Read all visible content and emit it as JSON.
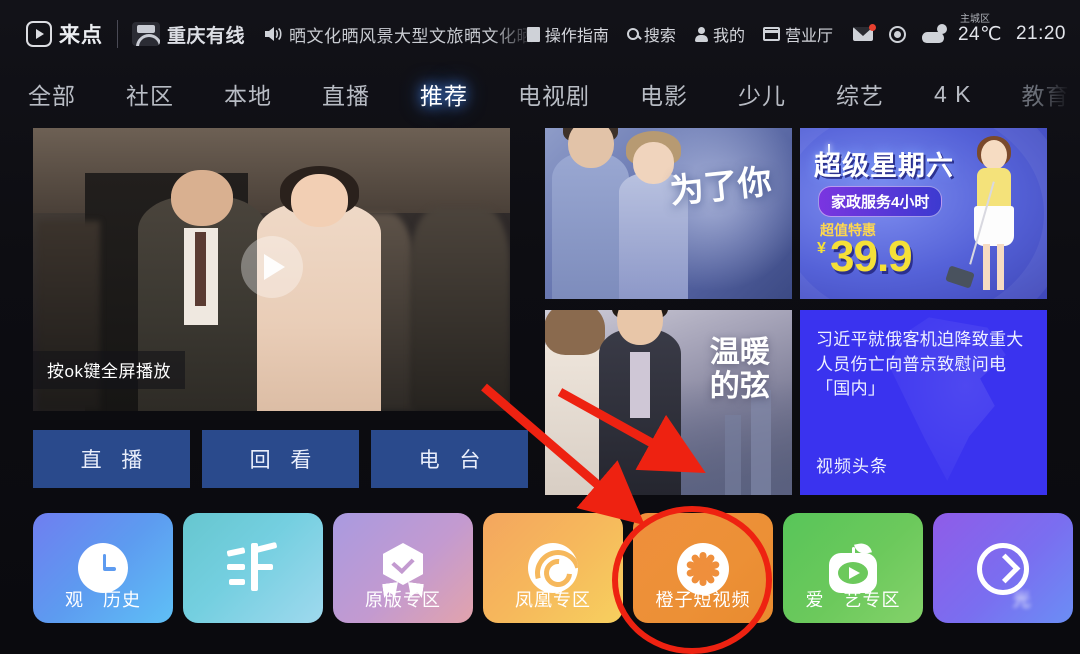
{
  "header": {
    "brand": "来点",
    "brand_icon": "play-logo-icon",
    "operator": "重庆有线",
    "operator_icon": "cable-wifi-icon",
    "speaker_icon": "speaker-icon",
    "marquee": "晒文化晒风景大型文旅晒文化晒",
    "menu": [
      {
        "label": "操作指南",
        "icon": "guide-book-icon"
      },
      {
        "label": "搜索",
        "icon": "search-icon"
      },
      {
        "label": "我的",
        "icon": "user-icon"
      },
      {
        "label": "营业厅",
        "icon": "shop-icon"
      }
    ],
    "mail_icon": "mail-icon",
    "mail_badge": true,
    "target_icon": "target-icon",
    "weather_icon": "sun-cloud-icon",
    "region": "主城区",
    "temperature": "24℃",
    "time": "21:20"
  },
  "nav": {
    "tabs": [
      {
        "label": "全部",
        "active": false
      },
      {
        "label": "社区",
        "active": false
      },
      {
        "label": "本地",
        "active": false
      },
      {
        "label": "直播",
        "active": false
      },
      {
        "label": "推荐",
        "active": true
      },
      {
        "label": "电视剧",
        "active": false
      },
      {
        "label": "电影",
        "active": false
      },
      {
        "label": "少儿",
        "active": false
      },
      {
        "label": "综艺",
        "active": false
      },
      {
        "label": "4 K",
        "active": false
      },
      {
        "label": "教育",
        "active": false
      }
    ]
  },
  "main": {
    "player": {
      "hint": "按ok键全屏播放",
      "play_icon": "play-icon"
    },
    "buttons": [
      {
        "label": "直 播"
      },
      {
        "label": "回 看"
      },
      {
        "label": "电 台"
      }
    ],
    "cards": {
      "drama_top": {
        "title": "为了你"
      },
      "ad": {
        "title": "超级星期六",
        "pill": "家政服务4小时",
        "subtitle": "超值特惠",
        "currency": "¥",
        "price": "39.9"
      },
      "drama_bottom": {
        "title_line1": "温暖",
        "title_line2": "的弦"
      },
      "news": {
        "headline": "习近平就俄客机迫降致重大人员伤亡向普京致慰问电「国内」",
        "tag": "视频头条"
      }
    }
  },
  "tiles": [
    {
      "label": "观　历史",
      "icon": "clock-icon",
      "blur": false,
      "highlighted": false
    },
    {
      "label": "",
      "icon": "fun-text-icon",
      "blur": true,
      "highlighted": false
    },
    {
      "label": "原版专区",
      "icon": "badge-check-icon",
      "blur": false,
      "highlighted": false
    },
    {
      "label": "凤凰专区",
      "icon": "phoenix-icon",
      "blur": false,
      "highlighted": false
    },
    {
      "label": "橙子短视频",
      "icon": "orange-slice-icon",
      "blur": false,
      "highlighted": true
    },
    {
      "label": "爱　艺专区",
      "icon": "iqiyi-icon",
      "blur": false,
      "highlighted": false
    },
    {
      "label": "　　光",
      "icon": "arrow-circle-icon",
      "blur": false,
      "highlighted": false
    }
  ],
  "annotations": {
    "highlight_color": "#ee2211",
    "arrows": 2,
    "circle_target": "橙子短视频"
  }
}
